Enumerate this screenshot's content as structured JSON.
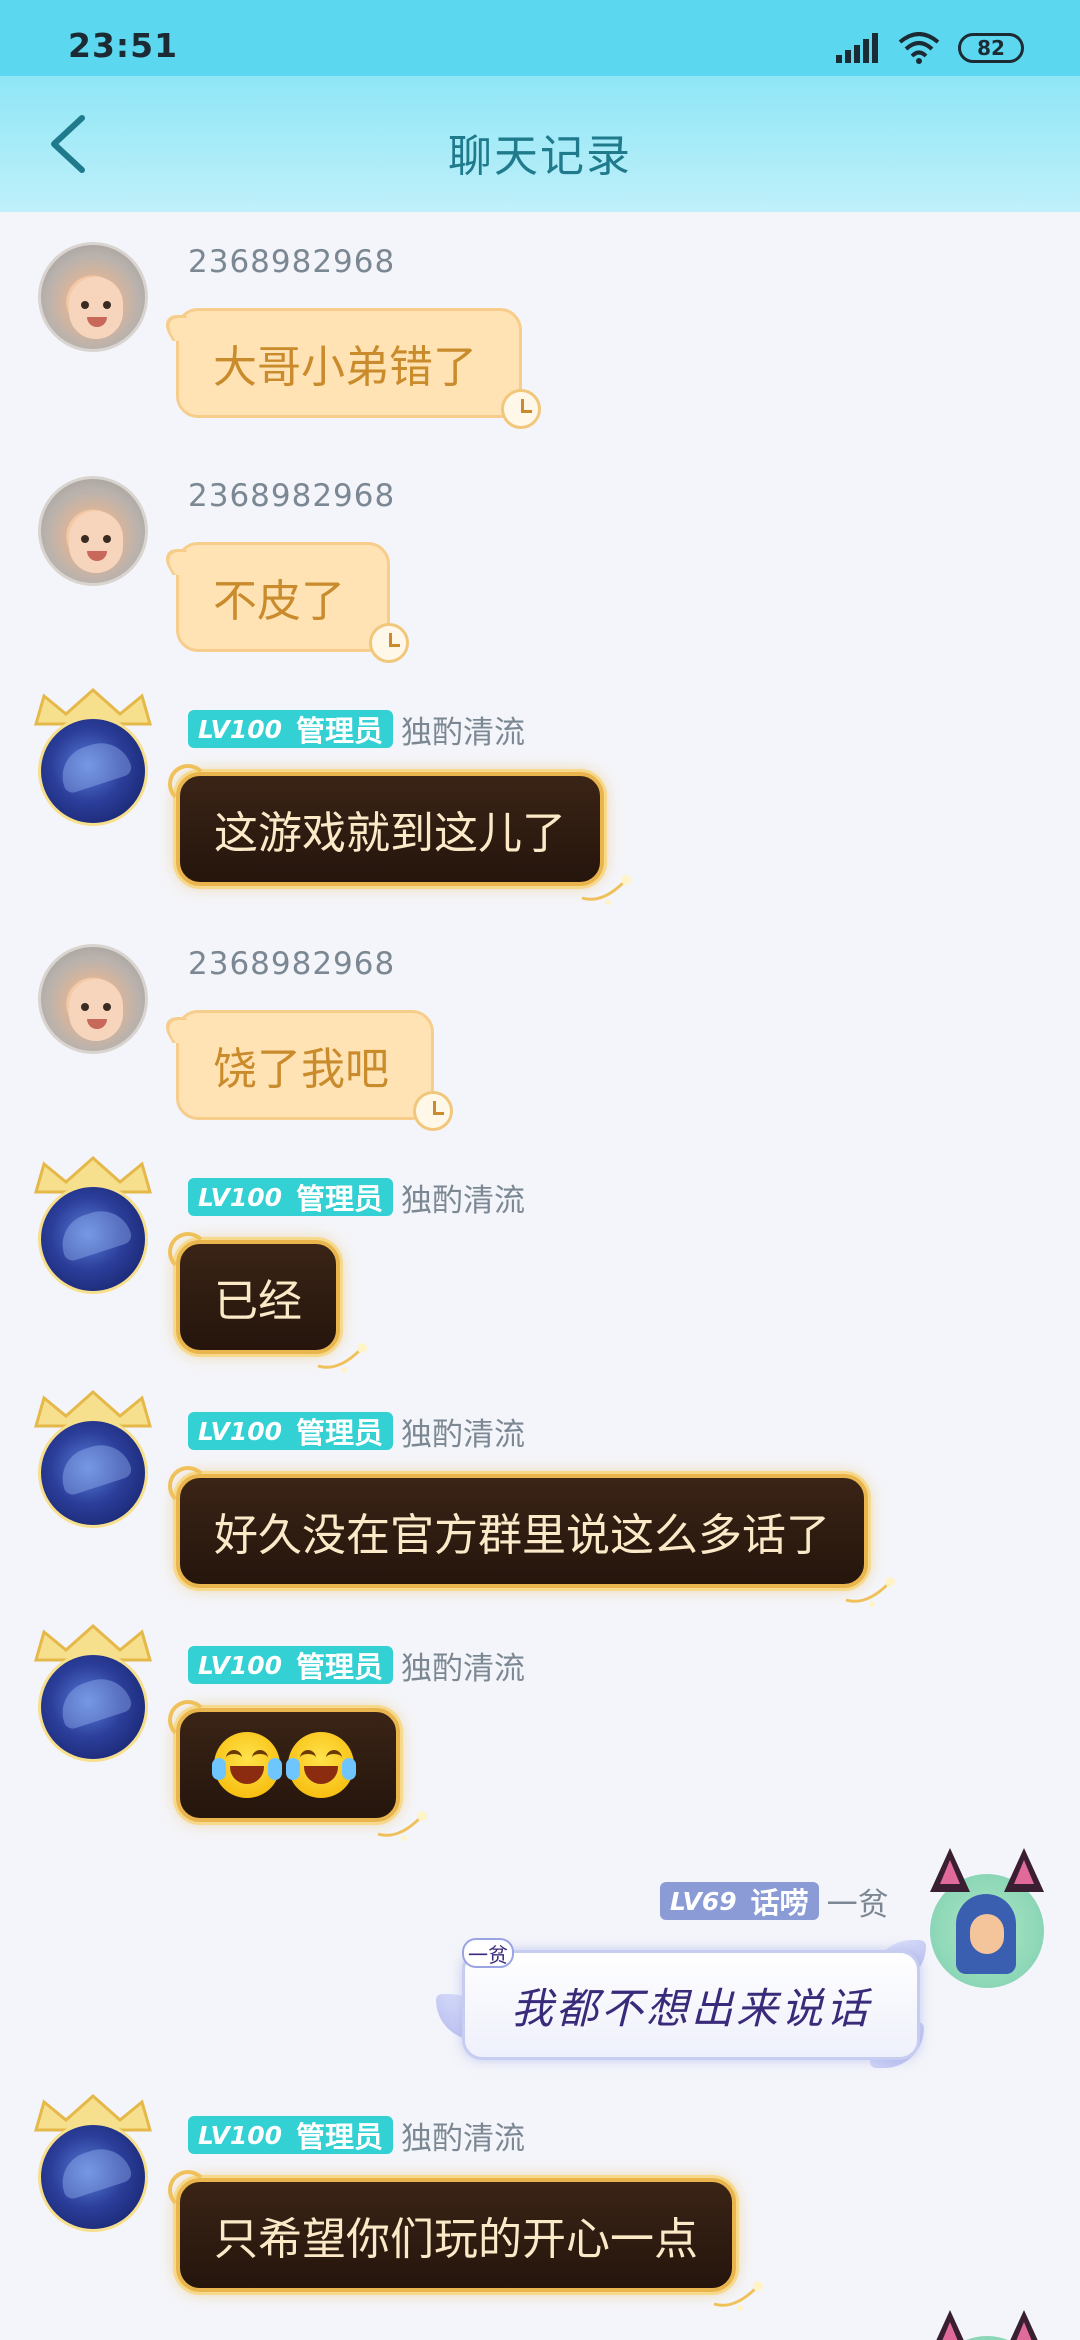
{
  "status_bar": {
    "time": "23:51",
    "battery": "82"
  },
  "header": {
    "title": "聊天记录"
  },
  "messages": [
    {
      "sender_id": "2368982968",
      "text": "大哥小弟错了"
    },
    {
      "sender_id": "2368982968",
      "text": "不皮了"
    },
    {
      "level": "LV100",
      "role": "管理员",
      "nickname": "独酌清流",
      "text": "这游戏就到这儿了"
    },
    {
      "sender_id": "2368982968",
      "text": "饶了我吧"
    },
    {
      "level": "LV100",
      "role": "管理员",
      "nickname": "独酌清流",
      "text": "已经"
    },
    {
      "level": "LV100",
      "role": "管理员",
      "nickname": "独酌清流",
      "text": "好久没在官方群里说这么多话了"
    },
    {
      "level": "LV100",
      "role": "管理员",
      "nickname": "独酌清流",
      "emojis": [
        "tears-of-joy",
        "tears-of-joy"
      ]
    },
    {
      "level": "LV69",
      "role": "话唠",
      "nickname": "一贫",
      "tag": "一贫",
      "text": "我都不想出来说话"
    },
    {
      "level": "LV100",
      "role": "管理员",
      "nickname": "独酌清流",
      "text": "只希望你们玩的开心一点"
    }
  ],
  "colors": {
    "status_bar": "#5bd8f0",
    "header_text": "#1f7a8c",
    "admin_badge": "#33d1d3",
    "light_bubble": "#ffe3b4",
    "dark_bubble": "#2e1c10",
    "gold": "#e9b54c"
  }
}
